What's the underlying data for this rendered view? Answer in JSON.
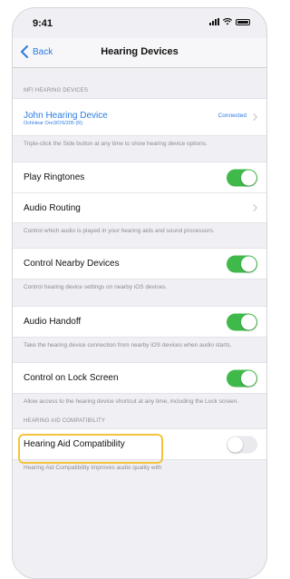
{
  "status_bar": {
    "time": "9:41"
  },
  "nav": {
    "back_label": "Back",
    "title": "Hearing Devices"
  },
  "mfi_section": {
    "header": "MFI HEARING DEVICES",
    "device_name": "John Hearing Device",
    "device_model": "OchHear Ore3/OS/205 (R)",
    "device_status": "Connected",
    "footer": "Triple-click the Side button at any time to show hearing device options."
  },
  "ringtones_group": {
    "play_ringtones_label": "Play Ringtones",
    "play_ringtones_on": true,
    "audio_routing_label": "Audio Routing",
    "footer": "Control which audio is played in your hearing aids and sound processors."
  },
  "nearby_group": {
    "label": "Control Nearby Devices",
    "on": true,
    "footer": "Control hearing device settings on nearby iOS devices."
  },
  "handoff_group": {
    "label": "Audio Handoff",
    "on": true,
    "footer": "Take the hearing device connection from nearby iOS devices when audio starts."
  },
  "lock_screen_group": {
    "label": "Control on Lock Screen",
    "on": true,
    "footer": "Allow access to the hearing device shortcut at any time, including the Lock screen."
  },
  "compat_section": {
    "header": "HEARING AID COMPATIBILITY",
    "label": "Hearing Aid Compatibility",
    "on": false,
    "footer": "Hearing Aid Compatibility improves audio quality with"
  },
  "colors": {
    "accent": "#2c7be5",
    "toggle_on": "#3fba4a",
    "toggle_off": "#e9e9ee",
    "highlight": "#f3c43c",
    "background": "#efeff4"
  }
}
